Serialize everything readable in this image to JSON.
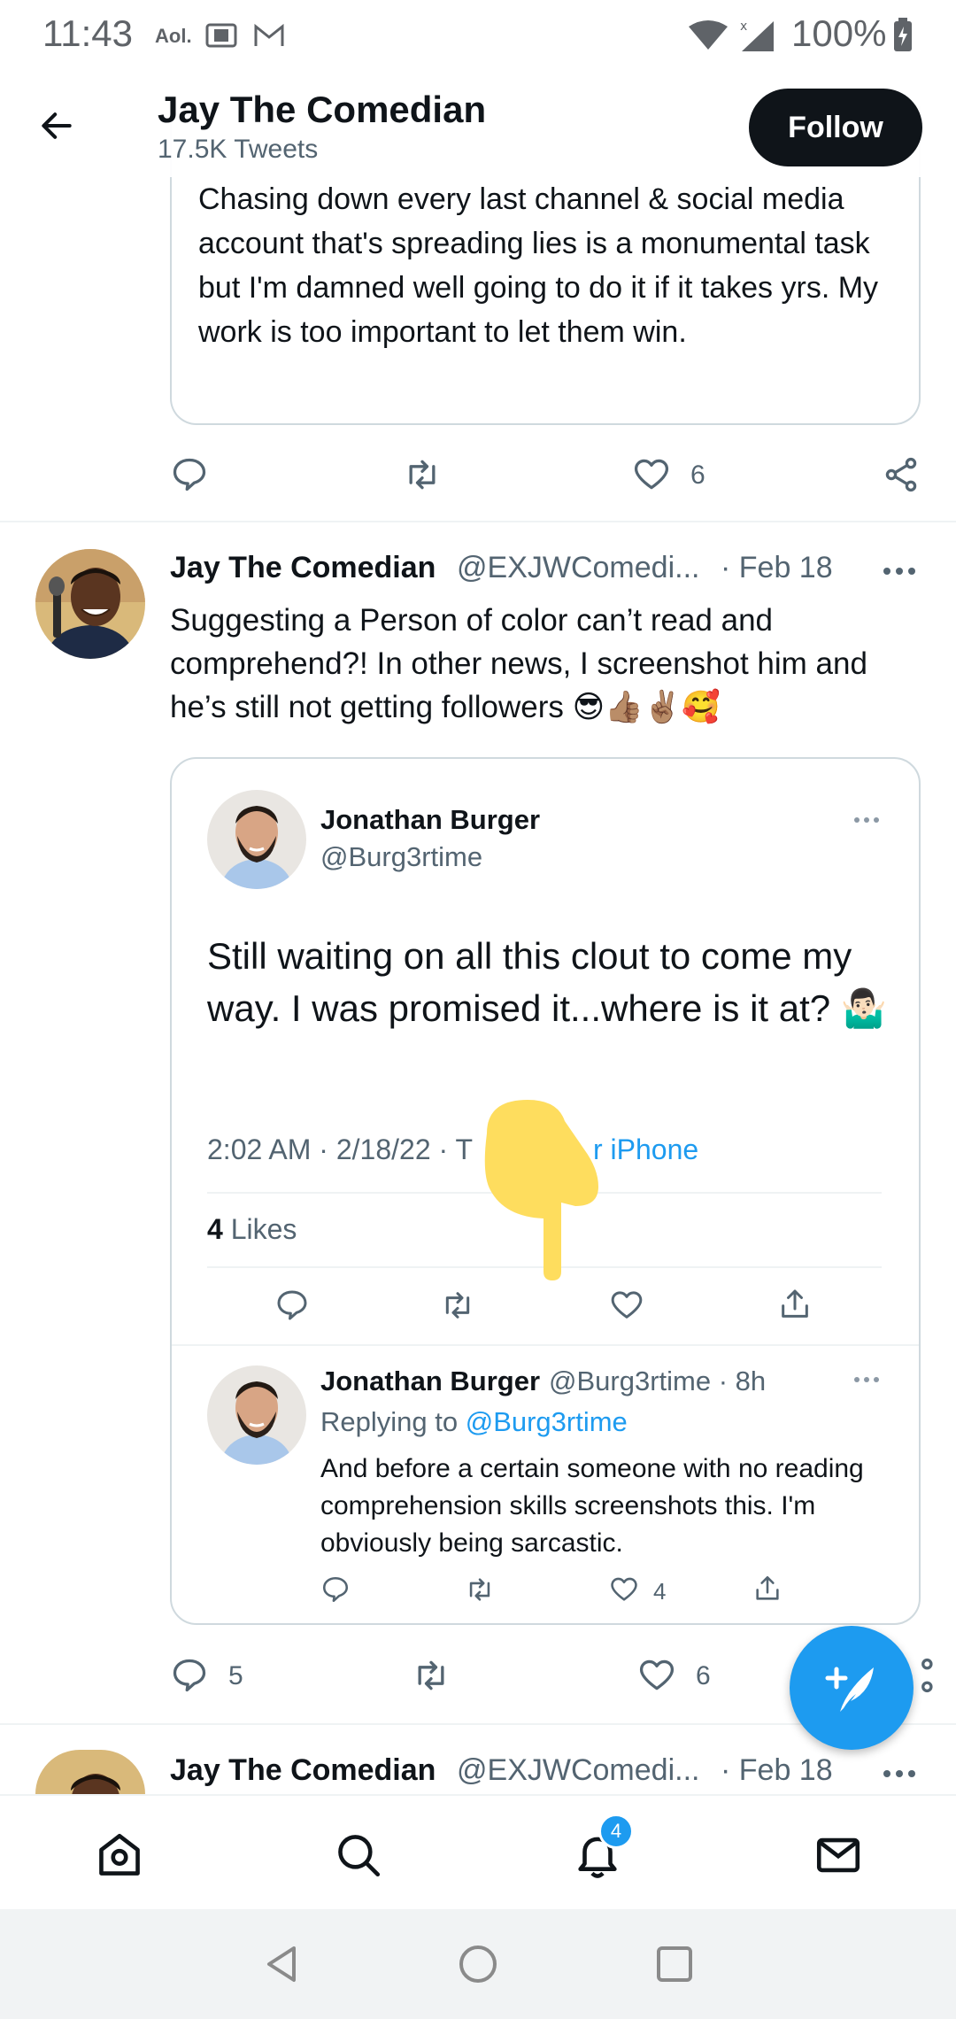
{
  "status_bar": {
    "time": "11:43",
    "aol": "Aol.",
    "battery": "100%",
    "icons": [
      "aol-icon",
      "amazon-icon",
      "gmail-icon",
      "wifi-icon",
      "signal-icon",
      "battery-icon"
    ]
  },
  "header": {
    "name": "Jay The Comedian",
    "tweet_count": "17.5K Tweets",
    "follow_label": "Follow"
  },
  "prev_tweet": {
    "quote_text": "Chasing down every last channel & social media account that's spreading lies is a monumental task but I'm damned well going to do it if it takes yrs. My work is too important to let them win.",
    "likes": "6"
  },
  "tweet": {
    "name": "Jay The Comedian",
    "handle": "@EXJWComedi...",
    "date": "· Feb 18",
    "text": "Suggesting a Person of color can’t read and comprehend?! In other news, I screenshot him and he’s still not getting followers 😎👍🏽✌🏽🥰",
    "replies": "5",
    "likes": "6"
  },
  "embedded": {
    "name": "Jonathan Burger",
    "handle": "@Burg3rtime",
    "text": "Still waiting on all this clout to come my way. I was promised it...where is it at? 🤷🏻‍♂️",
    "meta": "2:02 AM · 2/18/22 · T",
    "source": "r iPhone",
    "likes_count": "4",
    "likes_label": " Likes",
    "reply": {
      "name": "Jonathan Burger",
      "handle": "@Burg3rtime · 8h",
      "replying_to_label": "Replying to ",
      "replying_to": "@Burg3rtime",
      "text": "And before a certain someone with no reading comprehension skills screenshots this. I'm obviously being sarcastic.",
      "likes": "4"
    }
  },
  "next_tweet": {
    "name": "Jay The Comedian",
    "handle": "@EXJWComedi...",
    "date": "· Feb 18"
  },
  "nav": {
    "notifications_badge": "4"
  },
  "colors": {
    "accent": "#1d9bf0",
    "text": "#0f1419",
    "secondary": "#536471",
    "border": "#cfd9de",
    "pointer": "#fedd5e"
  }
}
